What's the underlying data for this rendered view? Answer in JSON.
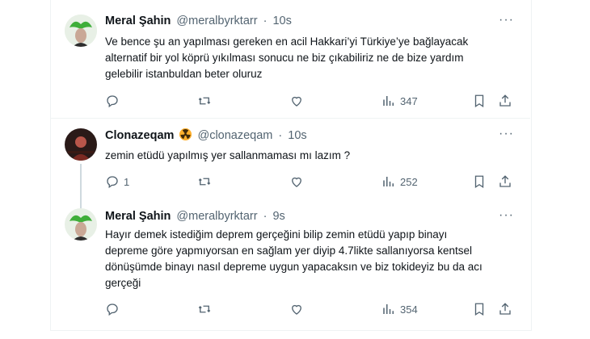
{
  "tweets": [
    {
      "name": "Meral Şahin",
      "handle": "@meralbyrktarr",
      "dot": "·",
      "time": "10s",
      "text": "Ve bence şu an yapılması gereken en acil Hakkari’yi Türkiye’ye bağlayacak alternatif bir yol köprü yıkılması sonucu ne biz çıkabiliriz ne de bize yardım gelebilir istanbuldan beter oluruz",
      "reply_count": "",
      "retweet_count": "",
      "like_count": "",
      "views": "347",
      "avatar_color": "#3fae3a"
    },
    {
      "name": "Clonazeqam",
      "handle": "@clonazeqam",
      "dot": "·",
      "time": "10s",
      "text": "zemin etüdü yapılmış yer  sallanmaması mı lazım ?",
      "reply_count": "1",
      "retweet_count": "",
      "like_count": "",
      "views": "252",
      "avatar_color": "#5a2a1c"
    },
    {
      "name": "Meral Şahin",
      "handle": "@meralbyrktarr",
      "dot": "·",
      "time": "9s",
      "text": "Hayır demek istediğim deprem gerçeğini bilip zemin etüdü yapıp binayı depreme göre yapmıyorsan en sağlam yer diyip 4.7likte sallanıyorsa kentsel dönüşümde binayı nasıl depreme uygun yapacaksın ve biz tokideyiz bu da acı gerçeği",
      "reply_count": "",
      "retweet_count": "",
      "like_count": "",
      "views": "354",
      "avatar_color": "#3fae3a"
    }
  ],
  "icons": [
    "reply-icon",
    "retweet-icon",
    "like-icon",
    "views-icon",
    "bookmark-icon",
    "share-icon",
    "more-icon"
  ],
  "colors": {
    "text": "#0f1419",
    "secondary": "#536471",
    "border": "#eff3f4"
  }
}
